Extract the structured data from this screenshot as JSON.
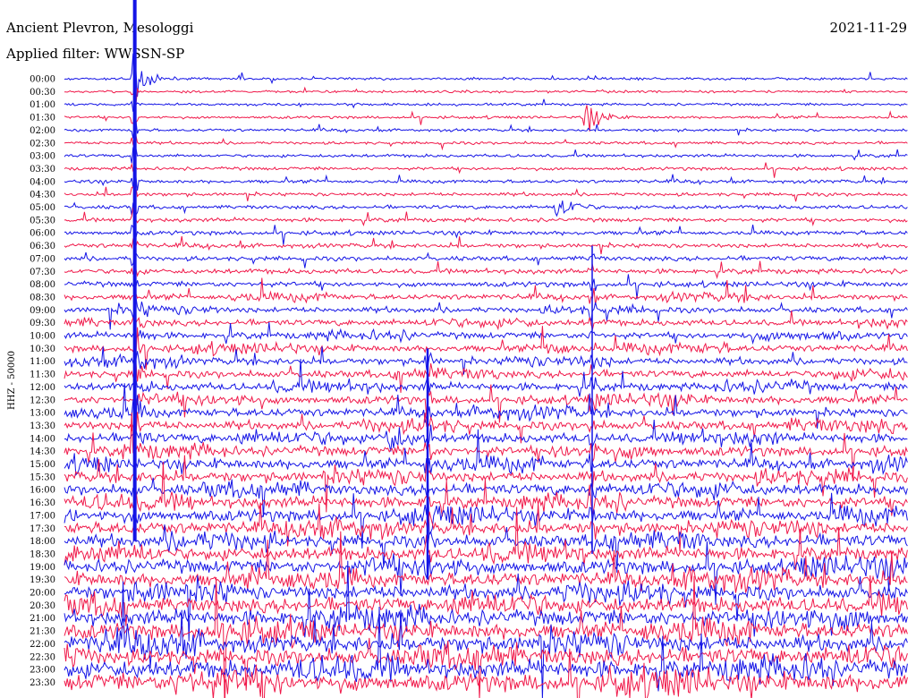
{
  "header": {
    "station": "Ancient Plevron, Mesologgi",
    "date": "2021-11-29",
    "filter": "Applied filter: WWSSN-SP"
  },
  "chart_data": {
    "type": "line",
    "title": "Ancient Plevron, Mesologgi",
    "ylabel": "HHZ - 50000",
    "xlabel": "",
    "row_labels": [
      "00:00",
      "00:30",
      "01:00",
      "01:30",
      "02:00",
      "02:30",
      "03:00",
      "03:30",
      "04:00",
      "04:30",
      "05:00",
      "05:30",
      "06:00",
      "06:30",
      "07:00",
      "07:30",
      "08:00",
      "08:30",
      "09:00",
      "09:30",
      "10:00",
      "10:30",
      "11:00",
      "11:30",
      "12:00",
      "12:30",
      "13:00",
      "13:30",
      "14:00",
      "14:30",
      "15:00",
      "15:30",
      "16:00",
      "16:30",
      "17:00",
      "17:30",
      "18:00",
      "18:30",
      "19:00",
      "19:30",
      "20:00",
      "20:30",
      "21:00",
      "21:30",
      "22:00",
      "22:30",
      "23:00",
      "23:30"
    ],
    "series_colors": [
      "#1414e6",
      "#f0194a"
    ],
    "grid": false,
    "legend": "none",
    "notable_events": [
      {
        "row": "00:00",
        "minute": 2.5,
        "note": "large event, coda through 17:30"
      },
      {
        "row": "01:30",
        "minute": 18.5
      },
      {
        "row": "05:00",
        "minute": 17.5
      },
      {
        "row": "10:30",
        "minute": 17.0
      },
      {
        "row": "14:00",
        "minute": 11.5
      }
    ]
  }
}
